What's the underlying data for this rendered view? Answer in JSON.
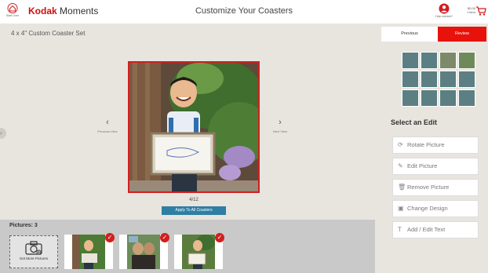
{
  "header": {
    "home_label": "Start Over",
    "logo_brand": "Kodak",
    "logo_product": "Moments",
    "title": "Customize Your Coasters",
    "help_label": "Help needed?",
    "price": "$0.00",
    "item_count": "1 item"
  },
  "canvas": {
    "set_title": "4 x 4\" Custom Coaster Set",
    "prev_view_label": "Previous View",
    "next_view_label": "Next View",
    "counter": "4/12",
    "apply_button": "Apply To All Coasters"
  },
  "pictures": {
    "title": "Pictures: 3",
    "get_more_label": "Get More Pictures"
  },
  "right_panel": {
    "previous_button": "Previous",
    "review_button": "Review",
    "select_edit_title": "Select an Edit",
    "edits": [
      {
        "label": "Rotate Picture",
        "icon": "rotate-icon"
      },
      {
        "label": "Edit Picture",
        "icon": "edit-icon"
      },
      {
        "label": "Remove Picture",
        "icon": "trash-icon"
      },
      {
        "label": "Change Design",
        "icon": "design-icon"
      },
      {
        "label": "Add / Edit Text",
        "icon": "text-icon"
      }
    ]
  },
  "colors": {
    "brand_red": "#e8120c",
    "apply_blue": "#2f7ea3",
    "canvas_bg": "#e8e5df",
    "strip_bg": "#c9c9c9"
  }
}
